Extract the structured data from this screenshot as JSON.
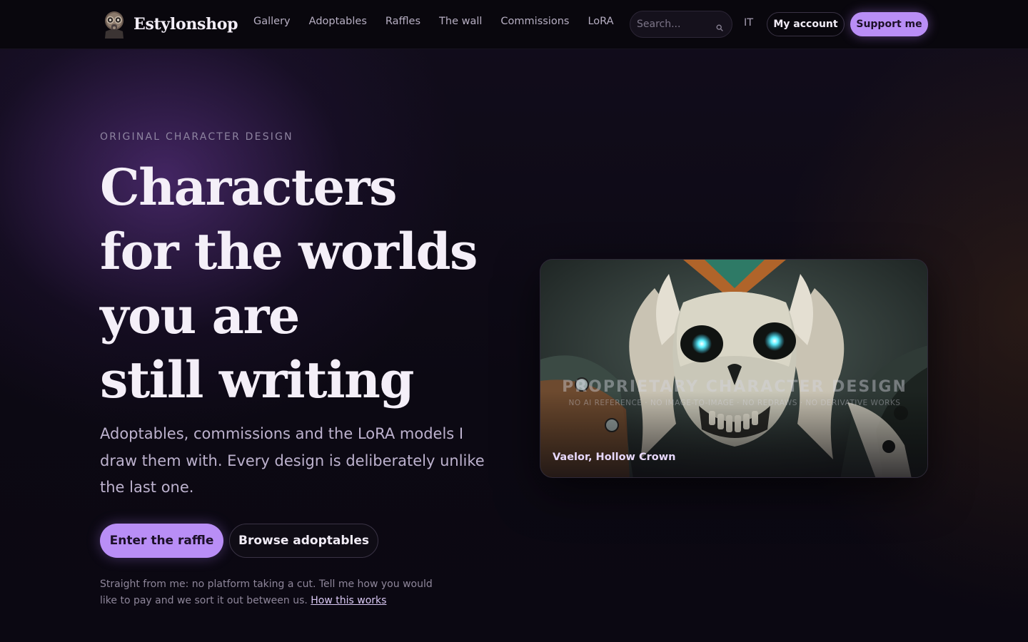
{
  "brand": {
    "name": "Estylonshop",
    "logo_icon": "gasmask-avatar-icon"
  },
  "nav": {
    "links": [
      "Gallery",
      "Adoptables",
      "Raffles",
      "The wall",
      "Commissions",
      "LoRA"
    ],
    "search_placeholder": "Search...",
    "search_value": "",
    "language": "IT",
    "account_label": "My account",
    "support_label": "Support me"
  },
  "hero": {
    "eyebrow": "ORIGINAL CHARACTER DESIGN",
    "title_lines": [
      "Characters",
      "for the worlds",
      "you are",
      "still writing"
    ],
    "subtitle": "Adoptables, commissions and the LoRA models I draw them with. Every design is deliberately unlike the last one.",
    "primary_cta": "Enter the raffle",
    "secondary_cta": "Browse adoptables",
    "note_text": "Straight from me: no platform taking a cut. Tell me how you would like to pay and we sort it out between us.",
    "note_link": "How this works"
  },
  "featured": {
    "watermark_title": "PROPRIETARY CHARACTER DESIGN",
    "watermark_sub": "NO AI REFERENCE · NO IMAGE-TO-IMAGE · NO REDRAWS · NO DERIVATIVE WORKS",
    "caption": "Vaelor, Hollow Crown"
  },
  "colors": {
    "accent": "#b98ef6",
    "background": "#0b0812",
    "eye_glow": "#5ff0ff"
  }
}
